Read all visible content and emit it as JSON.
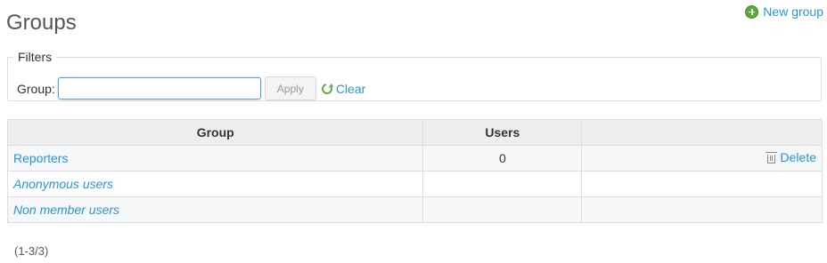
{
  "header": {
    "title": "Groups",
    "new_group_label": "New group"
  },
  "filters": {
    "legend": "Filters",
    "group_label": "Group:",
    "group_value": "",
    "group_placeholder": "",
    "apply_label": "Apply",
    "clear_label": "Clear"
  },
  "table": {
    "columns": [
      "Group",
      "Users",
      ""
    ],
    "rows": [
      {
        "name": "Reporters",
        "users": "0",
        "action": "Delete",
        "builtin": false
      },
      {
        "name": "Anonymous users",
        "users": "",
        "action": "",
        "builtin": true
      },
      {
        "name": "Non member users",
        "users": "",
        "action": "",
        "builtin": true
      }
    ]
  },
  "pagination": {
    "text": "(1-3/3)"
  },
  "colors": {
    "link": "#2996cc",
    "header_bg": "#eeeeee",
    "add_icon": "#5fa83c"
  }
}
